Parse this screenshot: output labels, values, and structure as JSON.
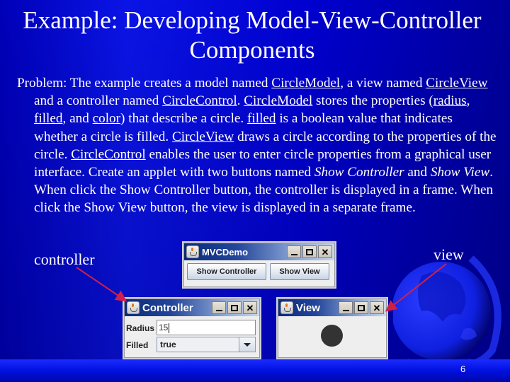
{
  "slide": {
    "title": "Example: Developing Model-View-Controller Components",
    "paragraph": [
      {
        "t": "Problem: The example creates a model named "
      },
      {
        "t": "CircleModel",
        "u": true
      },
      {
        "t": ", a view named "
      },
      {
        "t": "CircleView",
        "u": true
      },
      {
        "t": " and a controller named "
      },
      {
        "t": "CircleControl",
        "u": true
      },
      {
        "t": ". "
      },
      {
        "t": "CircleModel",
        "u": true
      },
      {
        "t": " stores the properties ("
      },
      {
        "t": "radius",
        "u": true
      },
      {
        "t": ", "
      },
      {
        "t": "filled",
        "u": true
      },
      {
        "t": ", and "
      },
      {
        "t": "color",
        "u": true
      },
      {
        "t": ") that describe a circle. "
      },
      {
        "t": "filled",
        "u": true
      },
      {
        "t": " is a boolean value that indicates whether a circle is filled. "
      },
      {
        "t": "CircleView",
        "u": true
      },
      {
        "t": " draws a circle according to the properties of the circle. "
      },
      {
        "t": "CircleControl",
        "u": true
      },
      {
        "t": " enables the user to enter circle properties from a graphical user interface. Create an applet with two buttons named "
      },
      {
        "t": "Show Controller",
        "i": true
      },
      {
        "t": " and "
      },
      {
        "t": "Show View",
        "i": true
      },
      {
        "t": ". When click the Show Controller button, the controller is displayed in a frame. When click the Show View button, the view is displayed in a separate frame."
      }
    ],
    "label_controller": "controller",
    "label_view": "view",
    "page_number": "6",
    "arrow_color": "#d0204a"
  },
  "windows": {
    "demo": {
      "title": "MVCDemo",
      "buttons": [
        "Show Controller",
        "Show View"
      ]
    },
    "controller": {
      "title": "Controller",
      "radius_label": "Radius",
      "radius_value": "15",
      "filled_label": "Filled",
      "filled_value": "true"
    },
    "view": {
      "title": "View",
      "circle_filled": true,
      "circle_color": "#333333"
    },
    "title_buttons": {
      "minimize": "_",
      "maximize": "□",
      "close": "✕"
    }
  }
}
